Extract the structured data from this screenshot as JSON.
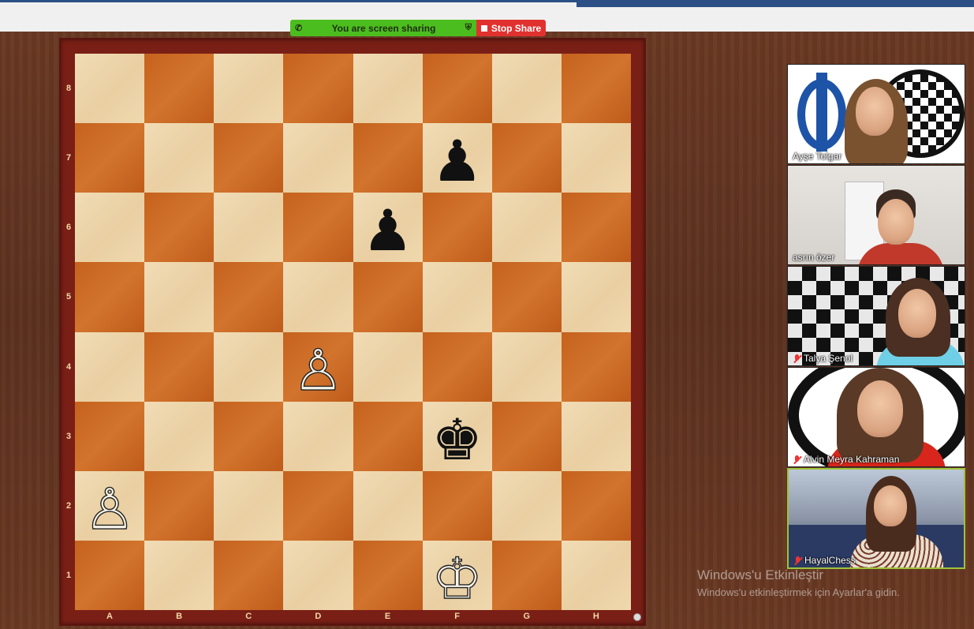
{
  "screen_share": {
    "status_text": "You are screen sharing",
    "stop_label": "Stop Share",
    "status_color": "#4cbd1f",
    "stop_color": "#e1312f"
  },
  "board": {
    "ranks": [
      "8",
      "7",
      "6",
      "5",
      "4",
      "3",
      "2",
      "1"
    ],
    "files": [
      "A",
      "B",
      "C",
      "D",
      "E",
      "F",
      "G",
      "H"
    ],
    "pieces": {
      "f7": {
        "color": "black",
        "type": "pawn",
        "glyph": "♟"
      },
      "e6": {
        "color": "black",
        "type": "pawn",
        "glyph": "♟"
      },
      "d4": {
        "color": "white",
        "type": "pawn",
        "glyph": "♙"
      },
      "f3": {
        "color": "black",
        "type": "king",
        "glyph": "♚"
      },
      "a2": {
        "color": "white",
        "type": "pawn",
        "glyph": "♙"
      },
      "f1": {
        "color": "white",
        "type": "king",
        "glyph": "♔"
      }
    }
  },
  "participants": [
    {
      "name": "Ayşe Tolgar",
      "muted": false,
      "active": false
    },
    {
      "name": "asrın özer",
      "muted": false,
      "active": false
    },
    {
      "name": "Talya Şenol",
      "muted": true,
      "active": false
    },
    {
      "name": "Alvin Meyra Kahraman",
      "muted": true,
      "active": false
    },
    {
      "name": "HayalChess",
      "muted": true,
      "active": true
    }
  ],
  "windows_notice": {
    "title": "Windows'u Etkinleştir",
    "subtitle": "Windows'u etkinleştirmek için Ayarlar'a gidin."
  }
}
